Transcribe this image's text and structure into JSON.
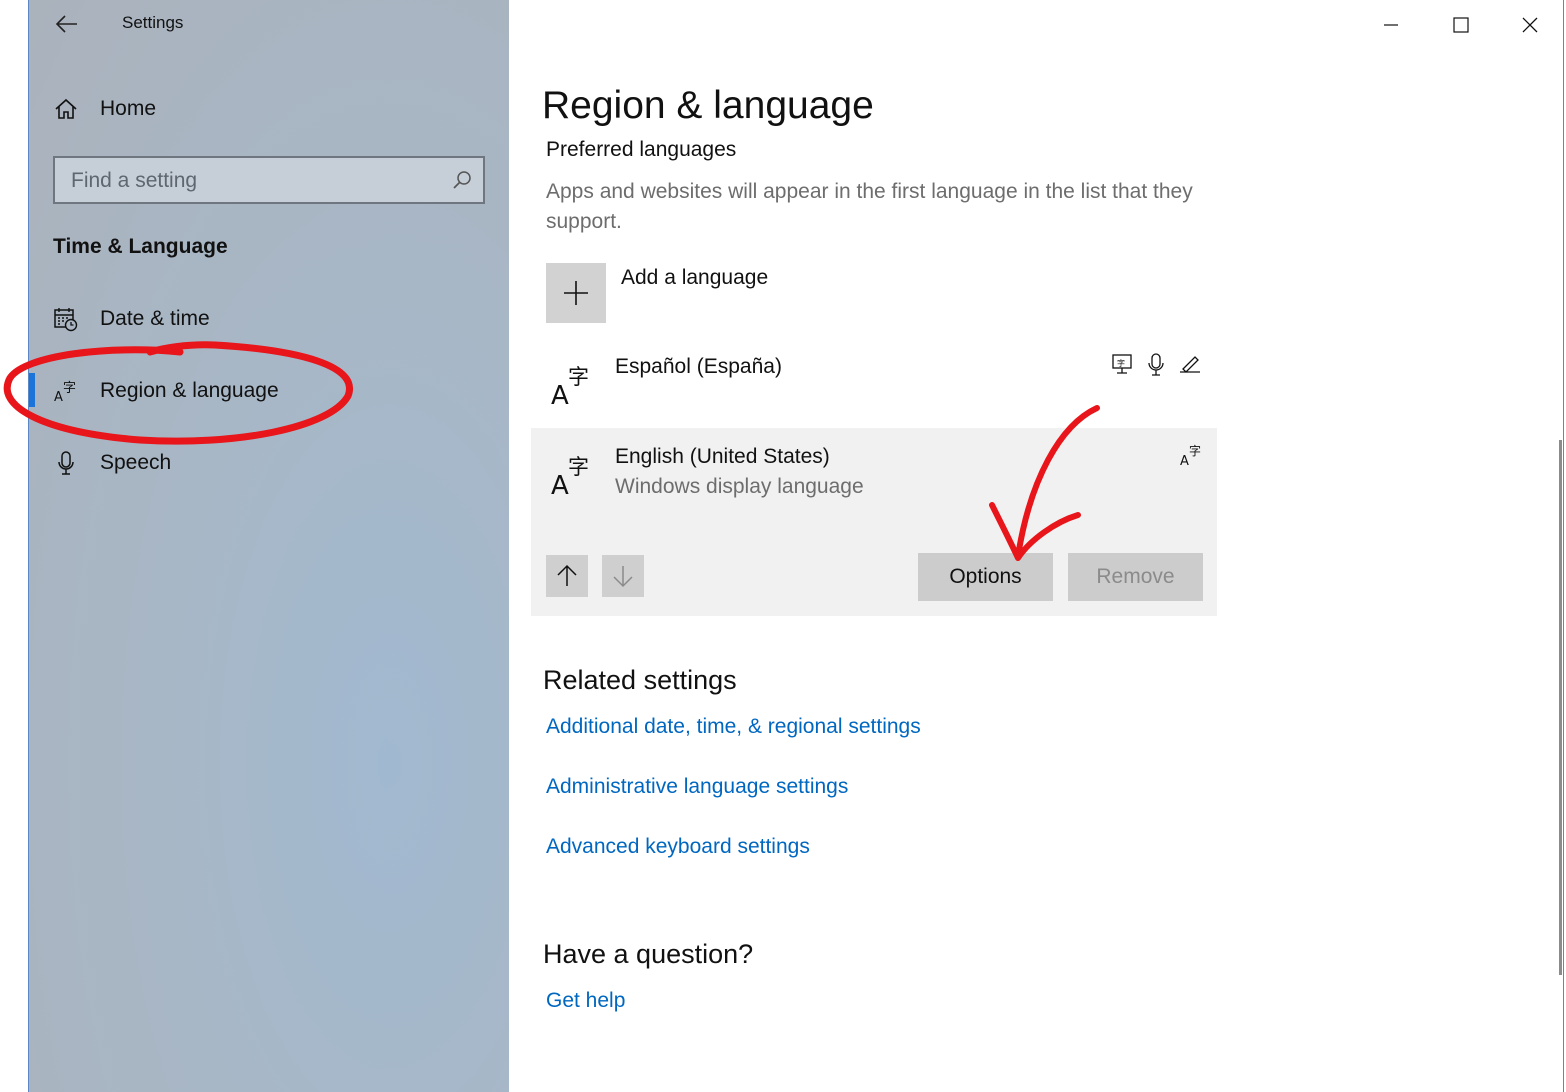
{
  "window": {
    "title": "Settings"
  },
  "sidebar": {
    "home_label": "Home",
    "search_placeholder": "Find a setting",
    "section_title": "Time & Language",
    "items": [
      {
        "label": "Date & time",
        "icon": "calendar-clock-icon"
      },
      {
        "label": "Region & language",
        "icon": "language-icon",
        "selected": true
      },
      {
        "label": "Speech",
        "icon": "microphone-icon"
      }
    ]
  },
  "main": {
    "title": "Region & language",
    "preferred_title": "Preferred languages",
    "preferred_desc": "Apps and websites will appear in the first language in the list that they support.",
    "add_language_label": "Add a language",
    "languages": [
      {
        "name": "Español (España)",
        "features": [
          "display-language-icon",
          "speech-icon",
          "handwriting-icon"
        ]
      },
      {
        "name": "English (United States)",
        "subtitle": "Windows display language",
        "features": [
          "language-pack-icon"
        ],
        "expanded": true
      }
    ],
    "options_label": "Options",
    "remove_label": "Remove",
    "related_title": "Related settings",
    "related_links": [
      "Additional date, time, & regional settings",
      "Administrative language settings",
      "Advanced keyboard settings"
    ],
    "question_title": "Have a question?",
    "help_link": "Get help"
  },
  "colors": {
    "accent": "#1d74d8",
    "link": "#0067c0",
    "annotation": "#e8151a"
  }
}
